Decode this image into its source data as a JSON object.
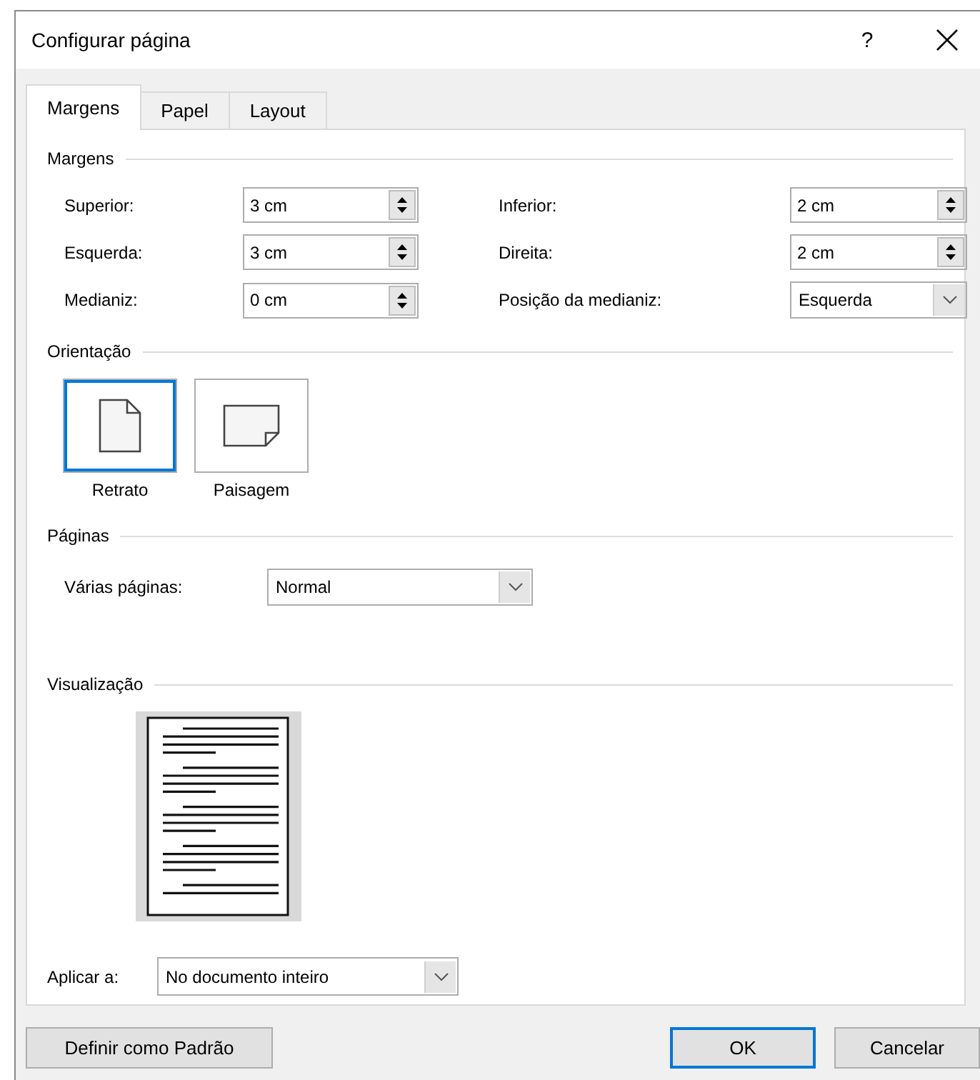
{
  "window": {
    "title": "Configurar página",
    "help": "?"
  },
  "tabs": [
    {
      "label": "Margens",
      "selected": true
    },
    {
      "label": "Papel",
      "selected": false
    },
    {
      "label": "Layout",
      "selected": false
    }
  ],
  "margins": {
    "title": "Margens",
    "fields": [
      {
        "label": "Superior:",
        "value": "3 cm",
        "kind": "spinner"
      },
      {
        "label": "Inferior:",
        "value": "2 cm",
        "kind": "spinner"
      },
      {
        "label": "Esquerda:",
        "value": "3 cm",
        "kind": "spinner"
      },
      {
        "label": "Direita:",
        "value": "2 cm",
        "kind": "spinner"
      },
      {
        "label": "Medianiz:",
        "value": "0 cm",
        "kind": "spinner"
      },
      {
        "label": "Posição da medianiz:",
        "value": "Esquerda",
        "kind": "dropdown"
      }
    ]
  },
  "orientation": {
    "title": "Orientação",
    "options": [
      {
        "label": "Retrato",
        "kind": "portrait",
        "selected": true
      },
      {
        "label": "Paisagem",
        "kind": "landscape",
        "selected": false
      }
    ]
  },
  "pages": {
    "title": "Páginas",
    "field": {
      "label": "Várias páginas:",
      "value": "Normal"
    }
  },
  "preview": {
    "title": "Visualização"
  },
  "apply": {
    "label": "Aplicar a:",
    "value": "No documento inteiro"
  },
  "default_button": {
    "label": "Definir como Padrão"
  },
  "buttons": [
    {
      "label": "OK",
      "focused": true
    },
    {
      "label": "Cancelar",
      "focused": false
    }
  ]
}
